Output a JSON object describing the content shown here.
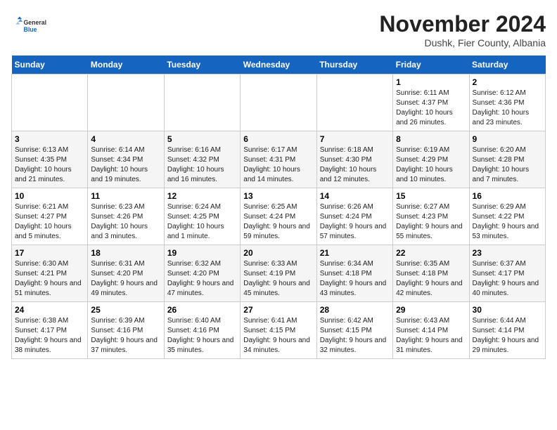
{
  "logo": {
    "general": "General",
    "blue": "Blue"
  },
  "title": "November 2024",
  "subtitle": "Dushk, Fier County, Albania",
  "days_of_week": [
    "Sunday",
    "Monday",
    "Tuesday",
    "Wednesday",
    "Thursday",
    "Friday",
    "Saturday"
  ],
  "weeks": [
    [
      {
        "day": "",
        "info": ""
      },
      {
        "day": "",
        "info": ""
      },
      {
        "day": "",
        "info": ""
      },
      {
        "day": "",
        "info": ""
      },
      {
        "day": "",
        "info": ""
      },
      {
        "day": "1",
        "info": "Sunrise: 6:11 AM\nSunset: 4:37 PM\nDaylight: 10 hours and 26 minutes."
      },
      {
        "day": "2",
        "info": "Sunrise: 6:12 AM\nSunset: 4:36 PM\nDaylight: 10 hours and 23 minutes."
      }
    ],
    [
      {
        "day": "3",
        "info": "Sunrise: 6:13 AM\nSunset: 4:35 PM\nDaylight: 10 hours and 21 minutes."
      },
      {
        "day": "4",
        "info": "Sunrise: 6:14 AM\nSunset: 4:34 PM\nDaylight: 10 hours and 19 minutes."
      },
      {
        "day": "5",
        "info": "Sunrise: 6:16 AM\nSunset: 4:32 PM\nDaylight: 10 hours and 16 minutes."
      },
      {
        "day": "6",
        "info": "Sunrise: 6:17 AM\nSunset: 4:31 PM\nDaylight: 10 hours and 14 minutes."
      },
      {
        "day": "7",
        "info": "Sunrise: 6:18 AM\nSunset: 4:30 PM\nDaylight: 10 hours and 12 minutes."
      },
      {
        "day": "8",
        "info": "Sunrise: 6:19 AM\nSunset: 4:29 PM\nDaylight: 10 hours and 10 minutes."
      },
      {
        "day": "9",
        "info": "Sunrise: 6:20 AM\nSunset: 4:28 PM\nDaylight: 10 hours and 7 minutes."
      }
    ],
    [
      {
        "day": "10",
        "info": "Sunrise: 6:21 AM\nSunset: 4:27 PM\nDaylight: 10 hours and 5 minutes."
      },
      {
        "day": "11",
        "info": "Sunrise: 6:23 AM\nSunset: 4:26 PM\nDaylight: 10 hours and 3 minutes."
      },
      {
        "day": "12",
        "info": "Sunrise: 6:24 AM\nSunset: 4:25 PM\nDaylight: 10 hours and 1 minute."
      },
      {
        "day": "13",
        "info": "Sunrise: 6:25 AM\nSunset: 4:24 PM\nDaylight: 9 hours and 59 minutes."
      },
      {
        "day": "14",
        "info": "Sunrise: 6:26 AM\nSunset: 4:24 PM\nDaylight: 9 hours and 57 minutes."
      },
      {
        "day": "15",
        "info": "Sunrise: 6:27 AM\nSunset: 4:23 PM\nDaylight: 9 hours and 55 minutes."
      },
      {
        "day": "16",
        "info": "Sunrise: 6:29 AM\nSunset: 4:22 PM\nDaylight: 9 hours and 53 minutes."
      }
    ],
    [
      {
        "day": "17",
        "info": "Sunrise: 6:30 AM\nSunset: 4:21 PM\nDaylight: 9 hours and 51 minutes."
      },
      {
        "day": "18",
        "info": "Sunrise: 6:31 AM\nSunset: 4:20 PM\nDaylight: 9 hours and 49 minutes."
      },
      {
        "day": "19",
        "info": "Sunrise: 6:32 AM\nSunset: 4:20 PM\nDaylight: 9 hours and 47 minutes."
      },
      {
        "day": "20",
        "info": "Sunrise: 6:33 AM\nSunset: 4:19 PM\nDaylight: 9 hours and 45 minutes."
      },
      {
        "day": "21",
        "info": "Sunrise: 6:34 AM\nSunset: 4:18 PM\nDaylight: 9 hours and 43 minutes."
      },
      {
        "day": "22",
        "info": "Sunrise: 6:35 AM\nSunset: 4:18 PM\nDaylight: 9 hours and 42 minutes."
      },
      {
        "day": "23",
        "info": "Sunrise: 6:37 AM\nSunset: 4:17 PM\nDaylight: 9 hours and 40 minutes."
      }
    ],
    [
      {
        "day": "24",
        "info": "Sunrise: 6:38 AM\nSunset: 4:17 PM\nDaylight: 9 hours and 38 minutes."
      },
      {
        "day": "25",
        "info": "Sunrise: 6:39 AM\nSunset: 4:16 PM\nDaylight: 9 hours and 37 minutes."
      },
      {
        "day": "26",
        "info": "Sunrise: 6:40 AM\nSunset: 4:16 PM\nDaylight: 9 hours and 35 minutes."
      },
      {
        "day": "27",
        "info": "Sunrise: 6:41 AM\nSunset: 4:15 PM\nDaylight: 9 hours and 34 minutes."
      },
      {
        "day": "28",
        "info": "Sunrise: 6:42 AM\nSunset: 4:15 PM\nDaylight: 9 hours and 32 minutes."
      },
      {
        "day": "29",
        "info": "Sunrise: 6:43 AM\nSunset: 4:14 PM\nDaylight: 9 hours and 31 minutes."
      },
      {
        "day": "30",
        "info": "Sunrise: 6:44 AM\nSunset: 4:14 PM\nDaylight: 9 hours and 29 minutes."
      }
    ]
  ]
}
